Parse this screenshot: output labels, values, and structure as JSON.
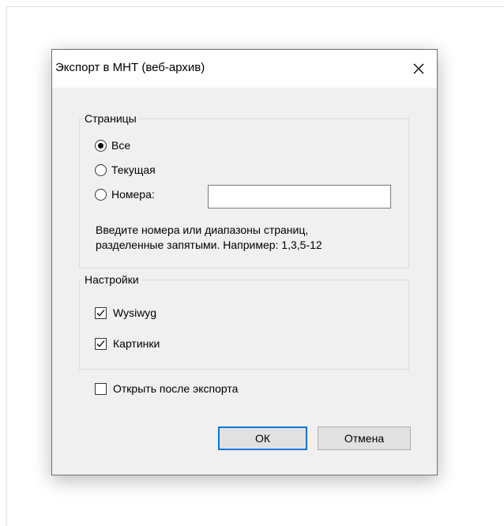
{
  "dialog": {
    "title": "Экспорт в МНТ (веб-архив)",
    "close_icon": "close-icon"
  },
  "pages_group": {
    "legend": "Страницы",
    "options": [
      {
        "label": "Все",
        "checked": true
      },
      {
        "label": "Текущая",
        "checked": false
      },
      {
        "label": "Номера:",
        "checked": false
      }
    ],
    "numbers_input_value": "",
    "hint_line1": "Введите номера или диапазоны страниц,",
    "hint_line2": "разделенные запятыми. Например: 1,3,5-12"
  },
  "settings_group": {
    "legend": "Настройки",
    "options": [
      {
        "label": "Wysiwyg",
        "checked": true
      },
      {
        "label": "Картинки",
        "checked": true
      }
    ]
  },
  "open_after_export": {
    "label": "Открыть после экспорта",
    "checked": false
  },
  "buttons": {
    "ok": "ОК",
    "cancel": "Отмена"
  },
  "colors": {
    "dialog_bg": "#f0f0f0",
    "focus_border": "#0078d7"
  }
}
